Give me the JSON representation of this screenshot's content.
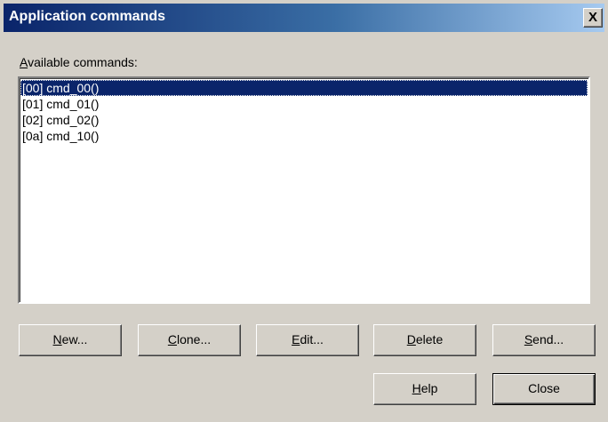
{
  "window": {
    "title": "Application commands",
    "close_glyph": "X"
  },
  "label": {
    "accel": "A",
    "rest": "vailable commands:"
  },
  "commands": [
    "[00] cmd_00()",
    "[01] cmd_01()",
    "[02] cmd_02()",
    "[0a] cmd_10()"
  ],
  "selected_index": 0,
  "buttons": {
    "new": {
      "accel": "N",
      "rest": "ew..."
    },
    "clone": {
      "accel": "C",
      "rest": "lone..."
    },
    "edit": {
      "accel": "E",
      "rest": "dit..."
    },
    "delete": {
      "accel": "D",
      "rest": "elete"
    },
    "send": {
      "accel": "S",
      "rest": "end..."
    },
    "help": {
      "accel": "H",
      "rest": "elp"
    },
    "close": {
      "label": "Close"
    }
  },
  "colors": {
    "titlebar_start": "#0a246a",
    "titlebar_end": "#a6caf0",
    "selection": "#0a246a",
    "face": "#d4d0c8"
  }
}
